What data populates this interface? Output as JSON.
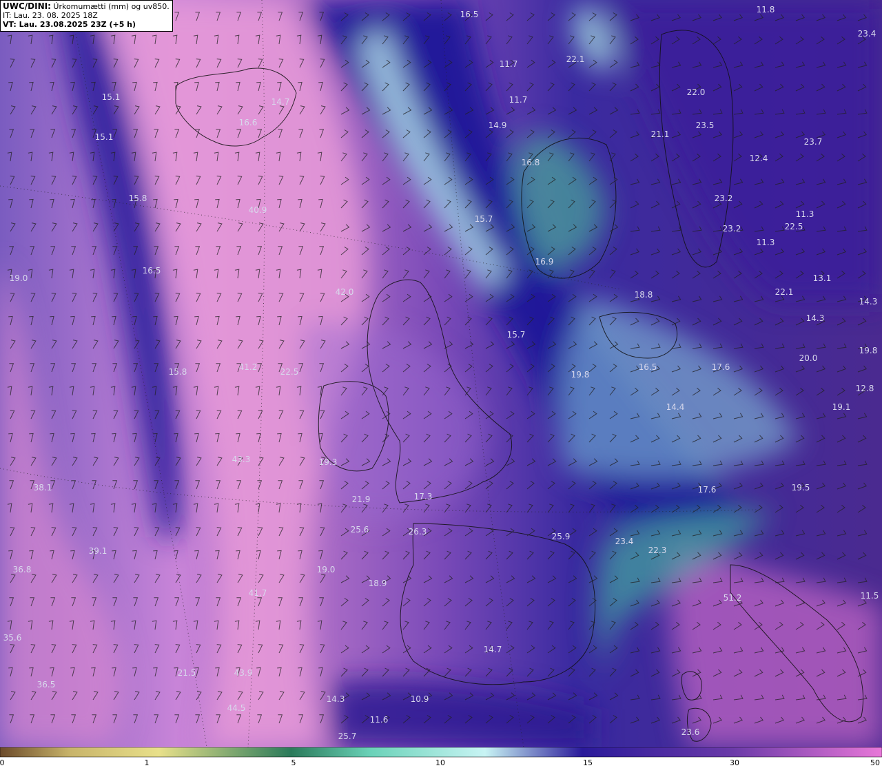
{
  "header": {
    "model": "UWC/DINI:",
    "title": " Úrkomumætti (mm) og uv850.",
    "it_line": "IT: Lau. 23. 08. 2025 18Z",
    "vt_line": "VT: Lau. 23.08.2025 23Z (+5 h)"
  },
  "map_values": [
    {
      "v": "16.5"
    },
    {
      "v": "11.8"
    },
    {
      "v": "23.4"
    },
    {
      "v": "22.1"
    },
    {
      "v": "11.7"
    },
    {
      "v": "11.7"
    },
    {
      "v": "22.0"
    },
    {
      "v": "15.1"
    },
    {
      "v": "14.7"
    },
    {
      "v": "16.6"
    },
    {
      "v": "15.1"
    },
    {
      "v": "14.9"
    },
    {
      "v": "23.5"
    },
    {
      "v": "21.1"
    },
    {
      "v": "23.7"
    },
    {
      "v": "16.8"
    },
    {
      "v": "12.4"
    },
    {
      "v": "15.8"
    },
    {
      "v": "40.9"
    },
    {
      "v": "23.2"
    },
    {
      "v": "15.7"
    },
    {
      "v": "11.3"
    },
    {
      "v": "23.2"
    },
    {
      "v": "22.5"
    },
    {
      "v": "11.3"
    },
    {
      "v": "16.9"
    },
    {
      "v": "19.0"
    },
    {
      "v": "16.5"
    },
    {
      "v": "13.1"
    },
    {
      "v": "42.0"
    },
    {
      "v": "18.8"
    },
    {
      "v": "22.1"
    },
    {
      "v": "14.3"
    },
    {
      "v": "14.3"
    },
    {
      "v": "15.7"
    },
    {
      "v": "20.0"
    },
    {
      "v": "19.8"
    },
    {
      "v": "41.2"
    },
    {
      "v": "22.5"
    },
    {
      "v": "15.8"
    },
    {
      "v": "16.5"
    },
    {
      "v": "17.6"
    },
    {
      "v": "19.8"
    },
    {
      "v": "12.8"
    },
    {
      "v": "19.1"
    },
    {
      "v": "14.4"
    },
    {
      "v": "43.3"
    },
    {
      "v": "19.3"
    },
    {
      "v": "38.1"
    },
    {
      "v": "17.3"
    },
    {
      "v": "17.6"
    },
    {
      "v": "19.5"
    },
    {
      "v": "21.9"
    },
    {
      "v": "25.6"
    },
    {
      "v": "26.3"
    },
    {
      "v": "25.9"
    },
    {
      "v": "23.4"
    },
    {
      "v": "39.1"
    },
    {
      "v": "22.3"
    },
    {
      "v": "36.8"
    },
    {
      "v": "19.0"
    },
    {
      "v": "18.9"
    },
    {
      "v": "41.7"
    },
    {
      "v": "51.2"
    },
    {
      "v": "11.5"
    },
    {
      "v": "35.6"
    },
    {
      "v": "14.7"
    },
    {
      "v": "21.5"
    },
    {
      "v": "43.9"
    },
    {
      "v": "36.5"
    },
    {
      "v": "14.3"
    },
    {
      "v": "10.9"
    },
    {
      "v": "44.5"
    },
    {
      "v": "11.6"
    },
    {
      "v": "25.7"
    },
    {
      "v": "23.6"
    }
  ],
  "colorbar": {
    "ticks": [
      "0",
      "1",
      "5",
      "10",
      "15",
      "30",
      "50"
    ],
    "colors": [
      "#6b4a2a",
      "#c8b46a",
      "#e8e08a",
      "#2a7a5a",
      "#6ad2b8",
      "#c8f4f4",
      "#2a1a9a",
      "#6a3aa8",
      "#e878d8"
    ]
  }
}
